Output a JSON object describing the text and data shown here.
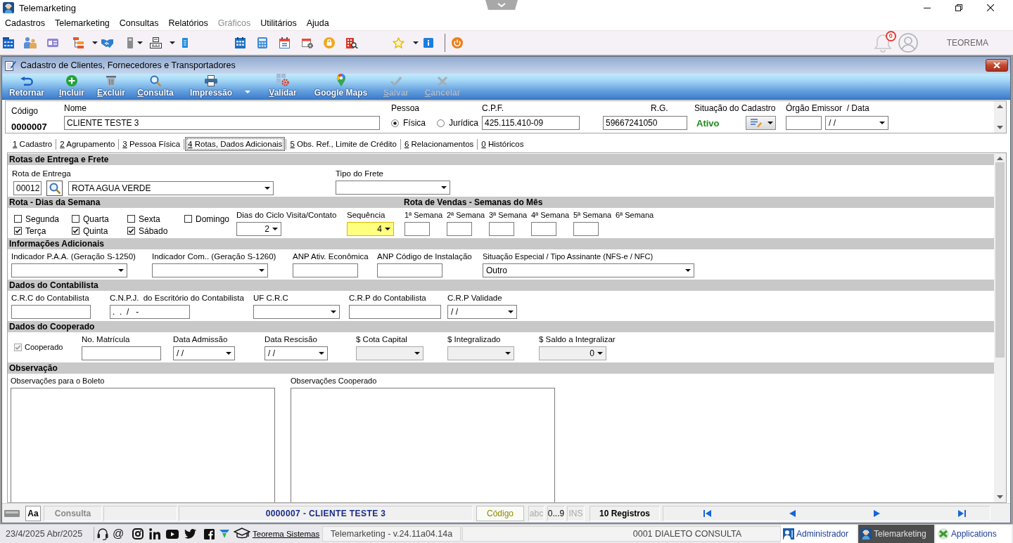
{
  "window": {
    "title": "Telemarketing"
  },
  "menu": [
    {
      "label": "Cadastros",
      "disabled": false
    },
    {
      "label": "Telemarketing",
      "disabled": false
    },
    {
      "label": "Consultas",
      "disabled": false
    },
    {
      "label": "Relatórios",
      "disabled": false
    },
    {
      "label": "Gráficos",
      "disabled": true
    },
    {
      "label": "Utilitários",
      "disabled": false
    },
    {
      "label": "Ajuda",
      "disabled": false
    }
  ],
  "toolbar": {
    "notification_count": "0",
    "user": "TEOREMA"
  },
  "form": {
    "title": "Cadastro de Clientes, Fornecedores e Transportadores",
    "actions": [
      {
        "label": "Retornar",
        "disabled": false,
        "accel": false,
        "menu": false
      },
      {
        "label": "Incluir",
        "disabled": false,
        "accel": true,
        "menu": false
      },
      {
        "label": "Excluir",
        "disabled": false,
        "accel": true,
        "menu": false
      },
      {
        "label": "Consulta",
        "disabled": false,
        "accel": true,
        "menu": false
      },
      {
        "label": "Impressão",
        "disabled": false,
        "accel": false,
        "menu": true
      },
      {
        "label": "Validar",
        "disabled": false,
        "accel": true,
        "menu": false
      },
      {
        "label": "Google Maps",
        "disabled": false,
        "accel": false,
        "menu": false
      },
      {
        "label": "Salvar",
        "disabled": true,
        "accel": true,
        "menu": false
      },
      {
        "label": "Cancelar",
        "disabled": true,
        "accel": true,
        "menu": false
      }
    ]
  },
  "record": {
    "code": {
      "label": "Código",
      "value": "0000007"
    },
    "name": {
      "label": "Nome",
      "value": "CLIENTE TESTE 3"
    },
    "person_type": {
      "label": "Pessoa",
      "options": [
        {
          "label": "Física",
          "selected": true
        },
        {
          "label": "Jurídica",
          "selected": false
        }
      ]
    },
    "cpf": {
      "label": "C.P.F.",
      "value": "425.115.410-09"
    },
    "rg": {
      "label": "R.G.",
      "value": "59667241050"
    },
    "status": {
      "label": "Situação do Cadastro",
      "value": "Ativo"
    },
    "issuer": {
      "label": "Órgão Emissor  / Data",
      "date": "/ /"
    }
  },
  "tabs": [
    {
      "label": "1 Cadastro",
      "selected": false
    },
    {
      "label": "2 Agrupamento",
      "selected": false
    },
    {
      "label": "3 Pessoa Física",
      "selected": false
    },
    {
      "label": "4 Rotas, Dados Adicionais",
      "selected": true
    },
    {
      "label": "5 Obs. Ref., Limite de Crédito",
      "selected": false
    },
    {
      "label": "6 Relacionamentos",
      "selected": false
    },
    {
      "label": "0 Históricos",
      "selected": false
    }
  ],
  "sections": [
    {
      "kind": "fields",
      "title": "Rotas de Entrega e Frete",
      "fields": [
        {
          "kind": "lookup",
          "label": "Rota de Entrega",
          "code": "00012",
          "value": "ROTA AGUA VERDE",
          "disabled": false
        },
        {
          "kind": "combo",
          "label": "Tipo do Frete",
          "disabled": false
        }
      ]
    },
    {
      "kind": "schedule",
      "title": "Rota - Dias da Semana",
      "days": [
        {
          "label": "Segunda",
          "checked": false
        },
        {
          "label": "Terça",
          "checked": true
        },
        {
          "label": "Quarta",
          "checked": false
        },
        {
          "label": "Quinta",
          "checked": true
        },
        {
          "label": "Sexta",
          "checked": false
        },
        {
          "label": "Sábado",
          "checked": true
        },
        {
          "label": "Domingo",
          "checked": false
        }
      ],
      "fields": [
        {
          "kind": "numeric",
          "label": "Dias do Ciclo Visita/Contato",
          "value": "2",
          "disabled": false,
          "focused": false
        },
        {
          "kind": "numeric",
          "label": "Sequência",
          "value": "4",
          "disabled": false,
          "focused": true
        }
      ],
      "weeks_title": "Rota de Vendas - Semanas do Mês",
      "weeks": [
        {
          "label": "1ª Semana",
          "kind": "input"
        },
        {
          "label": "2ª Semana",
          "kind": "input"
        },
        {
          "label": "3ª Semana",
          "kind": "input"
        },
        {
          "label": "4ª Semana",
          "kind": "input"
        },
        {
          "label": "5ª Semana",
          "kind": "input"
        },
        {
          "label": "6ª Semana",
          "kind": "label"
        }
      ]
    },
    {
      "kind": "fields",
      "title": "Informações Adicionais",
      "fields": [
        {
          "kind": "combo",
          "label": "Indicador P.A.A. (Geração S-1250)",
          "disabled": false
        },
        {
          "kind": "combo",
          "label": "Indicador Com.. (Geração S-1260)",
          "disabled": false
        },
        {
          "kind": "input",
          "label": "ANP Ativ. Econômica",
          "disabled": false
        },
        {
          "kind": "input",
          "label": "ANP Código de Instalação",
          "disabled": false
        },
        {
          "kind": "combo",
          "label": "Situação Especial / Tipo Assinante (NFS-e / NFC)",
          "value": "Outro",
          "disabled": false
        }
      ]
    },
    {
      "kind": "fields",
      "title": "Dados do Contabilista",
      "fields": [
        {
          "kind": "input",
          "label": "C.R.C do Contabilista",
          "disabled": false
        },
        {
          "kind": "input",
          "label": "C.N.P.J.  do Escritório do Contabilista",
          "value": ".  .  /   -",
          "disabled": false
        },
        {
          "kind": "combo",
          "label": "UF C.R.C",
          "disabled": false
        },
        {
          "kind": "input",
          "label": "C.R.P do Contabilista",
          "disabled": false
        },
        {
          "kind": "combo",
          "label": "C.R.P Validade",
          "value": "/ /",
          "disabled": false
        }
      ]
    },
    {
      "kind": "fields",
      "title": "Dados do Cooperado",
      "fields": [
        {
          "kind": "checkbox",
          "label": "Cooperado",
          "checked": true,
          "disabled": true
        },
        {
          "kind": "input",
          "label": "No. Matrícula",
          "disabled": false
        },
        {
          "kind": "combo",
          "label": "Data Admissão",
          "value": "/ /",
          "disabled": false
        },
        {
          "kind": "combo",
          "label": "Data Rescisão",
          "value": "/ /",
          "disabled": false
        },
        {
          "kind": "combo",
          "label": "$ Cota Capital",
          "disabled": true
        },
        {
          "kind": "combo",
          "label": "$ Integralizado",
          "disabled": true
        },
        {
          "kind": "numeric",
          "label": "$ Saldo a Integralizar",
          "value": "0",
          "disabled": true
        }
      ]
    },
    {
      "kind": "fields",
      "title": "Observação",
      "fields": [
        {
          "kind": "memo",
          "label": "Observações para o Boleto",
          "disabled": false
        },
        {
          "kind": "memo",
          "label": "Observações Cooperado",
          "disabled": false
        }
      ]
    }
  ],
  "status_bar": {
    "font_button": "Aa",
    "mode": "Consulta",
    "record": "0000007 - CLIENTE TESTE 3",
    "order": "Código",
    "indicators": [
      {
        "label": "abc",
        "on": false
      },
      {
        "label": "0...9",
        "on": true
      },
      {
        "label": "INS",
        "on": false
      }
    ],
    "count": "10 Registros"
  },
  "footer": {
    "date": "23/4/2025 Abr/2025",
    "contact_symbol": "@",
    "link": "Teorema Sistemas",
    "version": "Telemarketing - v.24.11a04.14a",
    "database": "0001 DIALETO CONSULTA",
    "taskbar": [
      {
        "label": "Administrador",
        "selected": false
      },
      {
        "label": "Telemarketing",
        "selected": true
      },
      {
        "label": "Applications",
        "selected": false
      }
    ]
  }
}
